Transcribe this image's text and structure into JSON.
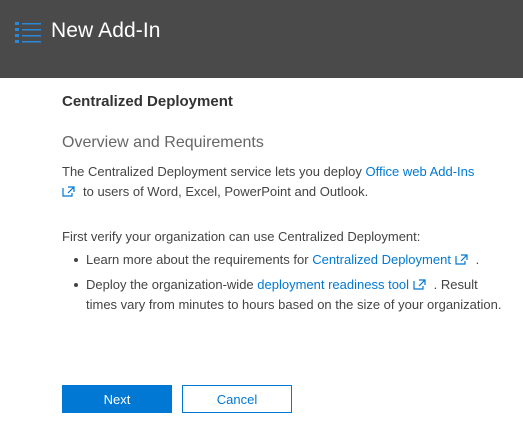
{
  "header": {
    "title": "New Add-In",
    "icon": "list-icon",
    "background_color": "#4a4a4a"
  },
  "main": {
    "section_title": "Centralized Deployment",
    "subtitle": "Overview and Requirements",
    "intro": {
      "text_before": "The Centralized Deployment service lets you deploy",
      "link_text": "Office web Add-Ins",
      "text_after": "to users of Word, Excel, PowerPoint and Outlook."
    },
    "verify_text": "First verify your organization can use Centralized Deployment:",
    "bullets": [
      {
        "text_before": "Learn more about the requirements for",
        "link_text": "Centralized Deployment",
        "text_after": "."
      },
      {
        "text_before": "Deploy the organization-wide",
        "link_text": "deployment readiness tool",
        "text_after": ". Result times vary from minutes to hours based on the size of your organization."
      }
    ]
  },
  "buttons": {
    "next_label": "Next",
    "cancel_label": "Cancel"
  },
  "colors": {
    "accent": "#0078d4",
    "header": "#4a4a4a"
  }
}
